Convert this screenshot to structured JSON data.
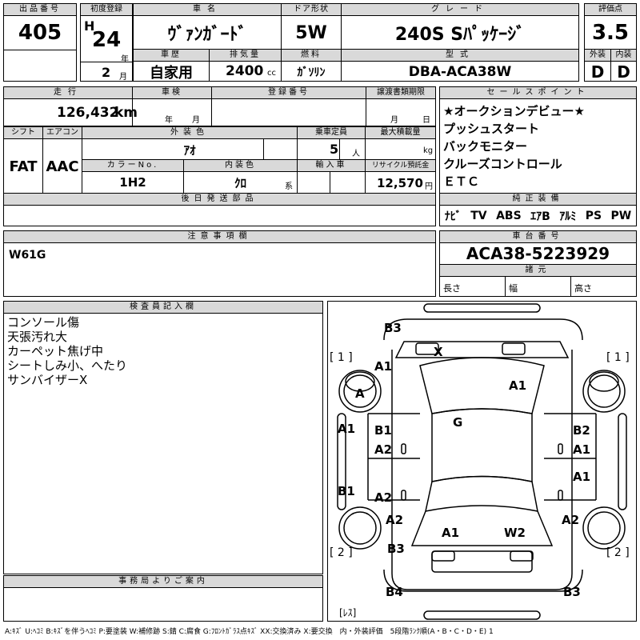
{
  "top": {
    "lot_label": "出品番号",
    "lot_value": "405",
    "reg_label": "初度登録",
    "reg_era": "H",
    "reg_year": "24",
    "reg_year_unit": "年",
    "reg_month": "2",
    "reg_month_unit": "月",
    "name_label": "車名",
    "name_value": "ｳﾞｧﾝｶﾞｰﾄﾞ",
    "history_label": "車歴",
    "history_value": "自家用",
    "disp_label": "排気量",
    "disp_value": "2400",
    "disp_unit": "cc",
    "door_label": "ドア形状",
    "door_value": "5W",
    "fuel_label": "燃料",
    "fuel_value": "ｶﾞｿﾘﾝ",
    "grade_label": "グレード",
    "grade_value": "240S Sﾊﾟｯｹｰｼﾞ",
    "model_label": "型式",
    "model_value": "DBA-ACA38W",
    "score_label": "評価点",
    "score_value": "3.5",
    "ext_label": "外装",
    "ext_value": "D",
    "int_label": "内装",
    "int_value": "D"
  },
  "row2": {
    "mileage_label": "走行",
    "mileage_value": "126,432",
    "mileage_unit": "km",
    "inspect_label": "車検",
    "inspect_year": "年",
    "inspect_month": "月",
    "plate_label": "登録番号",
    "transfer_label": "譲渡書類期限",
    "transfer_month": "月",
    "transfer_day": "日",
    "shift_label": "シフト",
    "shift_value": "FAT",
    "ac_label": "エアコン",
    "ac_value": "AAC",
    "color_label": "外装色",
    "color_value": "ｱｵ",
    "cap_label": "乗車定員",
    "cap_value": "5",
    "cap_unit": "人",
    "load_label": "最大積載量",
    "load_unit": "kg",
    "colorno_label": "カラーNo.",
    "colorno_value": "1H2",
    "intcolor_label": "内装色",
    "intcolor_value": "ｸﾛ",
    "intcolor_unit": "系",
    "import_label": "輸入車",
    "recycle_label": "リサイクル預託金",
    "recycle_value": "12,570",
    "recycle_unit": "円",
    "later_label": "後日発送部品"
  },
  "sales": {
    "label": "セールスポイント",
    "items": [
      "★オークションデビュー★",
      "プッシュスタート",
      "バックモニター",
      "クルーズコントロール",
      "ＥＴＣ"
    ]
  },
  "equipment": {
    "label": "純正装備",
    "items": [
      "ﾅﾋﾞ",
      "TV",
      "ABS",
      "ｴｱB",
      "ｱﾙﾐ",
      "PS",
      "PW"
    ]
  },
  "notes": {
    "label": "注意事項欄",
    "value": "W61G"
  },
  "chassis": {
    "label": "車台番号",
    "value": "ACA38-5223929",
    "specs_label": "諸元",
    "length": "長さ",
    "width": "幅",
    "height": "高さ"
  },
  "inspector": {
    "label": "検査員記入欄",
    "lines": [
      "コンソール傷",
      "天張汚れ大",
      "カーペット焦げ中",
      "シートしみ小、へたり",
      "サンバイザーX"
    ]
  },
  "office": {
    "label": "事務局よりご案内"
  },
  "diagram": {
    "tag_1_left": "[ 1 ]",
    "tag_1_right": "[ 1 ]",
    "tag_2_left": "[ 2 ]",
    "tag_2_right": "[ 2 ]",
    "tag_rear": "[ﾚｽ]",
    "m_b3_top": "B3",
    "m_x": "X",
    "m_a1_left_top": "A1",
    "m_a_wheel": "A",
    "m_a1_hood": "A1",
    "m_g": "G",
    "m_a1_side": "A1",
    "m_b1_left": "B1",
    "m_a2_left_1": "A2",
    "m_b2_right": "B2",
    "m_a1_right_1": "A1",
    "m_a1_right_2": "A1",
    "m_b1_left_low": "B1",
    "m_a2_left_2": "A2",
    "m_a2_left_rear": "A2",
    "m_a2_right_rear": "A2",
    "m_a1_rear": "A1",
    "m_w2": "W2",
    "m_b3_left": "B3",
    "m_b4": "B4",
    "m_b3_right": "B3"
  },
  "footer": {
    "legend": "A:ｷｽﾞ U:ﾍｺﾐ B:ｷｽﾞを伴うﾍｺﾐ P:要塗装 W:補修跡 S:錆 C:腐食 G:ﾌﾛﾝﾄｶﾞﾗｽ点ｷｽﾞ XX:交換済み X:要交換　内・外装評価　5段階ﾗﾝｸ順(A・B・C・D・E) 1"
  }
}
